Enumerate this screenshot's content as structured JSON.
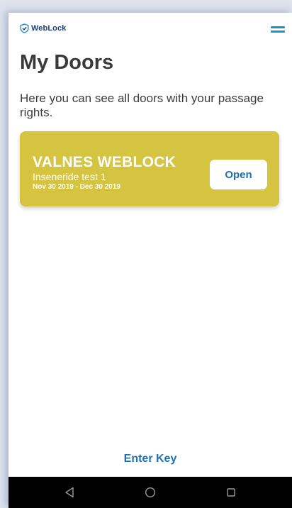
{
  "app": {
    "logo_text": "WebLock",
    "logo_color": "#1b3f7a"
  },
  "header": {
    "menu_icon": "hamburger-menu-icon",
    "accent_color": "#1c8fd3"
  },
  "page": {
    "title": "My Doors",
    "intro": "Here you can see all doors with your passage rights."
  },
  "doors": [
    {
      "name": "VALNES WEBLOCK",
      "subtitle": "Inseneride test 1",
      "dates": "Nov 30 2019 - Dec 30 2019",
      "action_label": "Open",
      "card_color": "#d5c43f"
    }
  ],
  "footer": {
    "enter_key_label": "Enter Key"
  },
  "system_nav": {
    "back_icon": "back-triangle-icon",
    "home_icon": "home-circle-icon",
    "recents_icon": "recents-square-icon"
  }
}
